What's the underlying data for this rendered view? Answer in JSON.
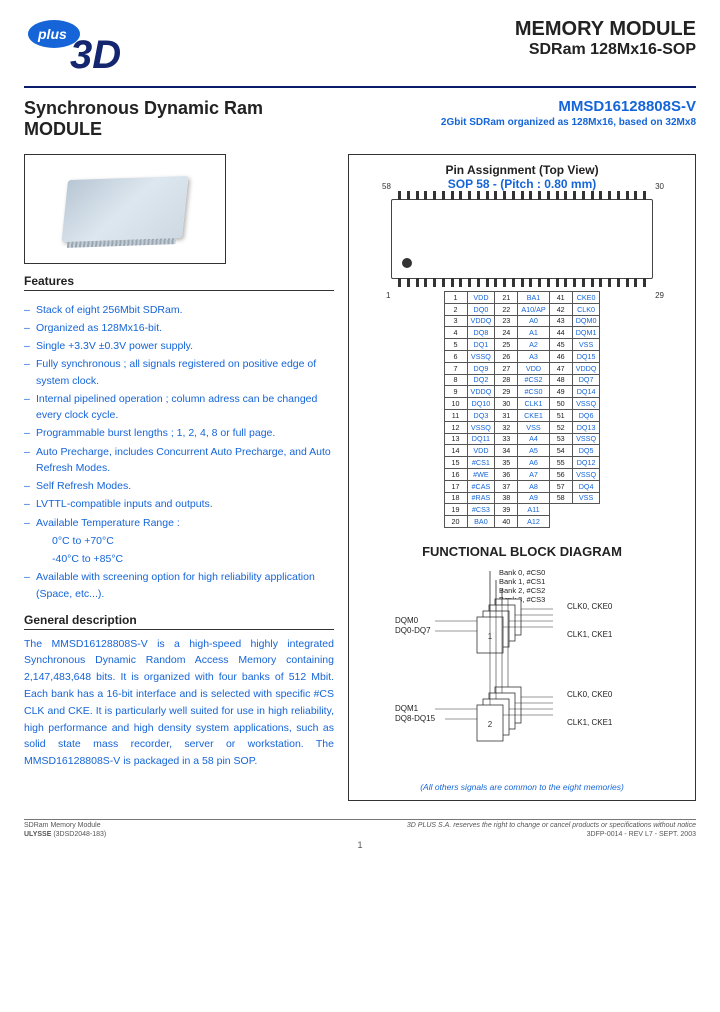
{
  "header": {
    "memory_module": "MEMORY MODULE",
    "sdram_line": "SDRam 128Mx16-SOP"
  },
  "title": {
    "line1": "Synchronous Dynamic Ram",
    "line2": "MODULE",
    "part": "MMSD16128808S-V",
    "desc": "2Gbit SDRam organized as 128Mx16, based on 32Mx8"
  },
  "sections": {
    "features": "Features",
    "pin_assignment": "Pin Assignment (Top View)",
    "sop_line": "SOP 58 - (Pitch : 0.80 mm)",
    "general": "General description",
    "fbd": "FUNCTIONAL BLOCK DIAGRAM"
  },
  "features": [
    "Stack of eight 256Mbit SDRam.",
    "Organized as 128Mx16-bit.",
    "Single +3.3V ±0.3V power supply.",
    "Fully synchronous ; all signals registered on positive edge of system clock.",
    "Internal pipelined operation ; column adress can be changed every clock cycle.",
    "Programmable burst lengths ; 1, 2, 4, 8 or full page.",
    "Auto Precharge, includes Concurrent Auto Precharge, and Auto Refresh Modes.",
    "Self Refresh Modes.",
    "LVTTL-compatible inputs and outputs.",
    "Available Temperature Range :"
  ],
  "temp_ranges": [
    "0°C to +70°C",
    "-40°C to +85°C"
  ],
  "features_tail": [
    "Available with screening option for high reliability application (Space, etc...)."
  ],
  "general_description": "The MMSD16128808S-V is a high-speed highly integrated Synchronous Dynamic Random Access Memory containing 2,147,483,648 bits. It is organized with four banks of 512 Mbit. Each bank has a 16-bit interface and is selected with specific #CS CLK and CKE. It is particularly well suited for use in high reliability, high performance and high density system applications, such as solid state mass recorder, server or workstation. The MMSD16128808S-V is packaged in a 58 pin SOP.",
  "pin_corners": {
    "p1": "1",
    "p29": "29",
    "p30": "30",
    "p58": "58"
  },
  "pin_table": {
    "rows": [
      [
        "1",
        "VDD",
        "21",
        "BA1",
        "41",
        "CKE0"
      ],
      [
        "2",
        "DQ0",
        "22",
        "A10/AP",
        "42",
        "CLK0"
      ],
      [
        "3",
        "VDDQ",
        "23",
        "A0",
        "43",
        "DQM0"
      ],
      [
        "4",
        "DQ8",
        "24",
        "A1",
        "44",
        "DQM1"
      ],
      [
        "5",
        "DQ1",
        "25",
        "A2",
        "45",
        "VSS"
      ],
      [
        "6",
        "VSSQ",
        "26",
        "A3",
        "46",
        "DQ15"
      ],
      [
        "7",
        "DQ9",
        "27",
        "VDD",
        "47",
        "VDDQ"
      ],
      [
        "8",
        "DQ2",
        "28",
        "#CS2",
        "48",
        "DQ7"
      ],
      [
        "9",
        "VDDQ",
        "29",
        "#CS0",
        "49",
        "DQ14"
      ],
      [
        "10",
        "DQ10",
        "30",
        "CLK1",
        "50",
        "VSSQ"
      ],
      [
        "11",
        "DQ3",
        "31",
        "CKE1",
        "51",
        "DQ6"
      ],
      [
        "12",
        "VSSQ",
        "32",
        "VSS",
        "52",
        "DQ13"
      ],
      [
        "13",
        "DQ11",
        "33",
        "A4",
        "53",
        "VSSQ"
      ],
      [
        "14",
        "VDD",
        "34",
        "A5",
        "54",
        "DQ5"
      ],
      [
        "15",
        "#CS1",
        "35",
        "A6",
        "55",
        "DQ12"
      ],
      [
        "16",
        "#WE",
        "36",
        "A7",
        "56",
        "VSSQ"
      ],
      [
        "17",
        "#CAS",
        "37",
        "A8",
        "57",
        "DQ4"
      ],
      [
        "18",
        "#RAS",
        "38",
        "A9",
        "58",
        "VSS"
      ],
      [
        "19",
        "#CS3",
        "39",
        "A11",
        "",
        ""
      ],
      [
        "20",
        "BA0",
        "40",
        "A12",
        "",
        ""
      ]
    ]
  },
  "fbd": {
    "banks": [
      "Bank 0, #CS0",
      "Bank 1, #CS1",
      "Bank 2, #CS2",
      "Bank 3, #CS3"
    ],
    "dqm0": "DQM0",
    "dq07": "DQ0-DQ7",
    "dqm1": "DQM1",
    "dq815": "DQ8-DQ15",
    "clk0cke0_a": "CLK0, CKE0",
    "clk1cke1_a": "CLK1, CKE1",
    "clk0cke0_b": "CLK0, CKE0",
    "clk1cke1_b": "CLK1, CKE1",
    "note": "(All others signals are common to the eight memories)"
  },
  "footer": {
    "left_top": "SDRam Memory Module",
    "right_top": "3D PLUS S.A. reserves the right to change or cancel products or specifications without notice",
    "ulysse": "ULYSSE",
    "code": "(3DSD2048-183)",
    "rev": "3DFP-0014 - REV L7   -  SEPT. 2003",
    "page": "1"
  }
}
